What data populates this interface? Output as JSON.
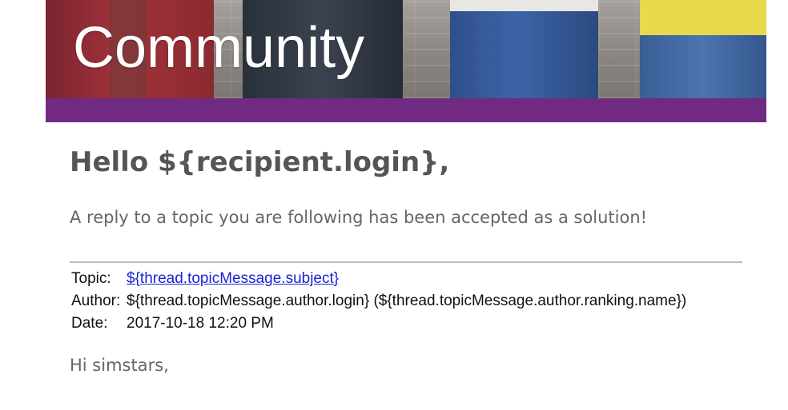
{
  "banner": {
    "title": "Community"
  },
  "colors": {
    "accent_bar": "#702a82",
    "link": "#1b24d6",
    "heading_text": "#555555",
    "body_text": "#666666"
  },
  "email": {
    "greeting": "Hello ${recipient.login},",
    "intro": "A reply to a topic you are following has been accepted as a solution!",
    "meta": {
      "topic_label": "Topic:",
      "topic_value": "${thread.topicMessage.subject}",
      "author_label": "Author:",
      "author_value": "${thread.topicMessage.author.login} (${thread.topicMessage.author.ranking.name})",
      "date_label": "Date:",
      "date_value": "2017-10-18 12:20 PM"
    },
    "salutation": "Hi simstars,"
  }
}
